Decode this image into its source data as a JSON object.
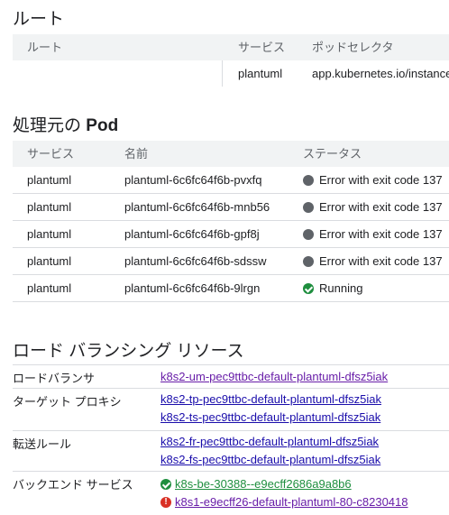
{
  "routes": {
    "title": "ルート",
    "headers": [
      "ルート",
      "サービス",
      "ポッドセレクタ"
    ],
    "rows": [
      {
        "route": "",
        "service": "plantuml",
        "selector": "app.kubernetes.io/instance"
      }
    ]
  },
  "pods": {
    "title_prefix": "処理元の",
    "title_bold": "Pod",
    "headers": [
      "サービス",
      "名前",
      "ステータス"
    ],
    "rows": [
      {
        "service": "plantuml",
        "name": "plantuml-6c6fc64f6b-pvxfq",
        "status": "Error with exit code 137",
        "status_icon": "error"
      },
      {
        "service": "plantuml",
        "name": "plantuml-6c6fc64f6b-mnb56",
        "status": "Error with exit code 137",
        "status_icon": "error"
      },
      {
        "service": "plantuml",
        "name": "plantuml-6c6fc64f6b-gpf8j",
        "status": "Error with exit code 137",
        "status_icon": "error"
      },
      {
        "service": "plantuml",
        "name": "plantuml-6c6fc64f6b-sdssw",
        "status": "Error with exit code 137",
        "status_icon": "error"
      },
      {
        "service": "plantuml",
        "name": "plantuml-6c6fc64f6b-9lrgn",
        "status": "Running",
        "status_icon": "check"
      }
    ]
  },
  "lb": {
    "title": "ロード バランシング リソース",
    "load_balancer_label": "ロードバランサ",
    "load_balancer_link": "k8s2-um-pec9ttbc-default-plantuml-dfsz5iak",
    "proxy_label": "ターゲット プロキシ",
    "proxy_links": [
      "k8s2-tp-pec9ttbc-default-plantuml-dfsz5iak",
      "k8s2-ts-pec9ttbc-default-plantuml-dfsz5iak"
    ],
    "forwarding_label": "転送ルール",
    "forwarding_links": [
      "k8s2-fr-pec9ttbc-default-plantuml-dfsz5iak",
      "k8s2-fs-pec9ttbc-default-plantuml-dfsz5iak"
    ],
    "backend_label": "バックエンド サービス",
    "backend_links": [
      {
        "text": "k8s-be-30388--e9ecff2686a9a8b6",
        "status_icon": "check"
      },
      {
        "text": "k8s1-e9ecff26-default-plantuml-80-c8230418",
        "status_icon": "error"
      }
    ]
  },
  "colors": {
    "link": "#1a0dab",
    "visited": "#681da8",
    "ok": "#1e8e3e",
    "fail": "#d93025"
  },
  "icons": {
    "error": "error-circle-icon",
    "check": "check-circle-icon",
    "fail": "exclamation-circle-icon"
  }
}
